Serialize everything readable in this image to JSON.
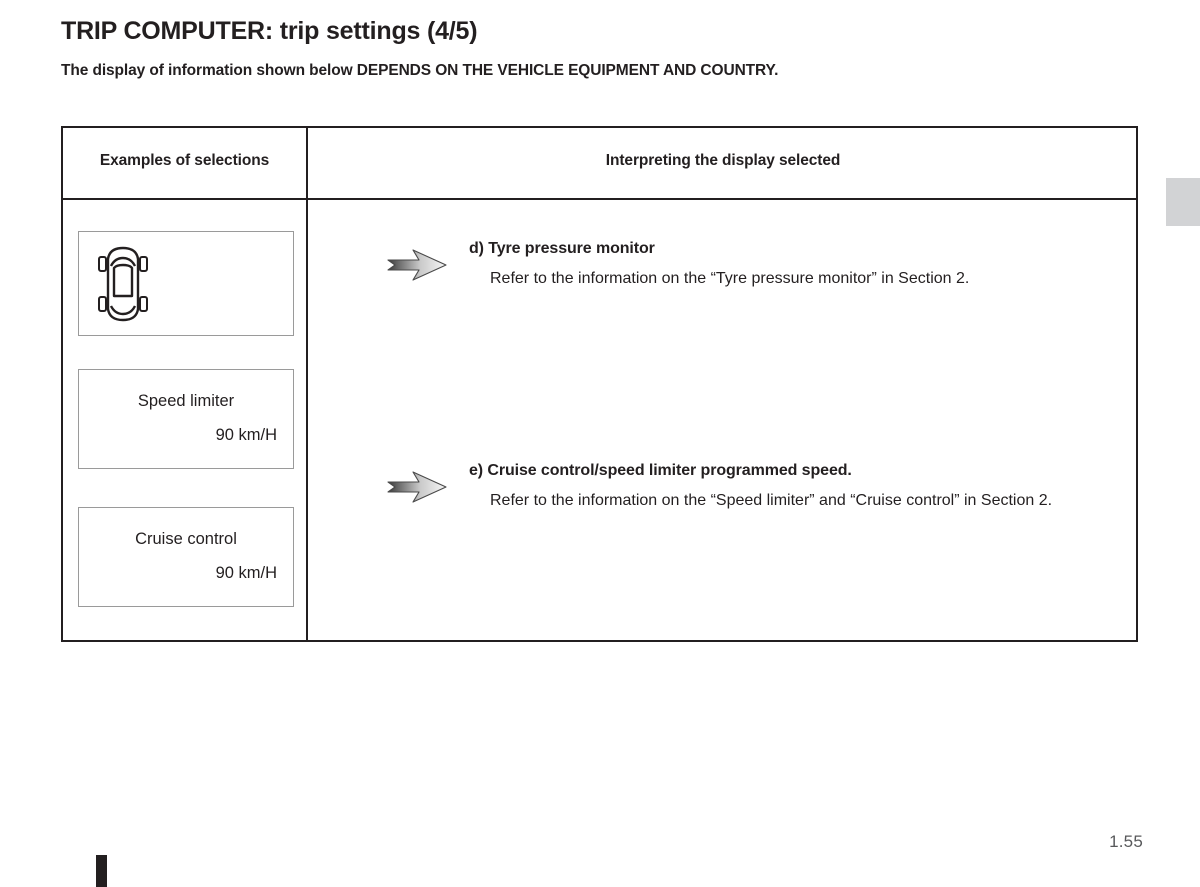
{
  "header": {
    "title": "TRIP COMPUTER: trip settings (4/5)",
    "subtitle": "The display of information shown below DEPENDS ON THE VEHICLE EQUIPMENT AND COUNTRY."
  },
  "table": {
    "columns": {
      "left_header": "Examples of selections",
      "right_header": "Interpreting the display selected"
    },
    "displays": [
      {
        "type": "icon",
        "icon": "car-top-view-tyre-pressure-icon",
        "label": "",
        "value": ""
      },
      {
        "type": "text",
        "label": "Speed limiter",
        "value": "90 km/H"
      },
      {
        "type": "text",
        "label": "Cruise control",
        "value": "90 km/H"
      }
    ],
    "entries": [
      {
        "arrow_icon": "right-arrow-icon",
        "title": "d) Tyre pressure monitor",
        "body": "Refer to the information on the “Tyre pressure monitor” in Section 2."
      },
      {
        "arrow_icon": "right-arrow-icon",
        "title": "e) Cruise control/speed limiter programmed speed.",
        "body": "Refer to the information on the “Speed limiter” and “Cruise control” in Section 2."
      }
    ]
  },
  "footer": {
    "page_number": "1.55"
  },
  "colors": {
    "text": "#231f20",
    "table_border": "#231f20",
    "display_border": "#9a9a9a",
    "side_tab": "#d2d3d5",
    "page_number": "#58595b",
    "background": "#ffffff"
  }
}
